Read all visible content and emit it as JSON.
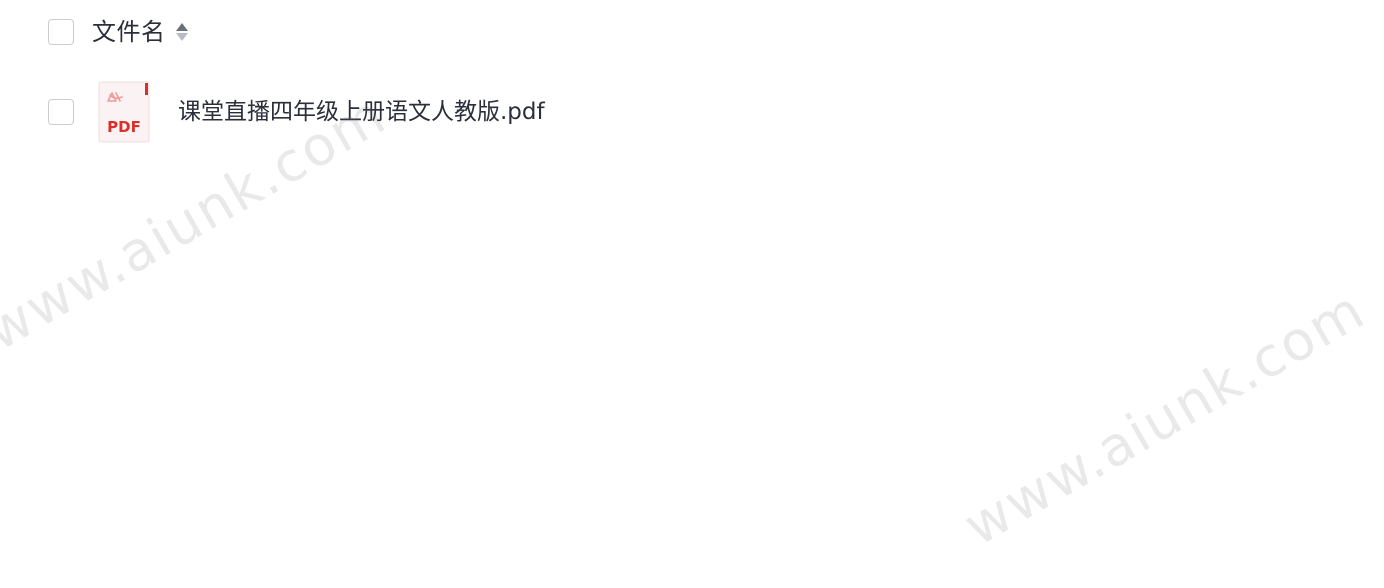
{
  "list_header": {
    "column_label": "文件名",
    "sort_icon": "sort-updown-icon"
  },
  "files": [
    {
      "name": "课堂直播四年级上册语文人教版.pdf",
      "icon": "pdf-file-icon",
      "icon_label": "PDF",
      "icon_color": "#d9302c"
    }
  ],
  "watermarks": [
    "www.aiunk.com",
    "www.aiunk.com"
  ],
  "colors": {
    "text": "#2b2f3a",
    "checkbox_border": "#c9ccd3",
    "pdf_red": "#d9302c"
  }
}
